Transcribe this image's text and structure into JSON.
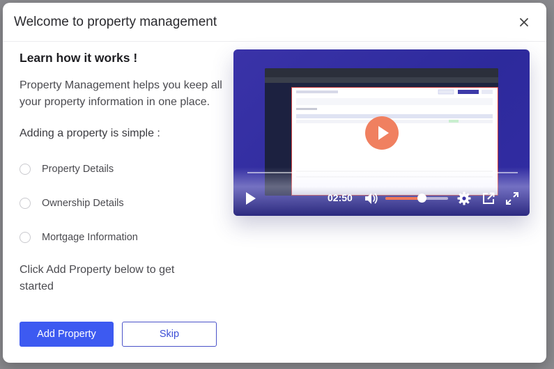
{
  "modal": {
    "title": "Welcome to property management",
    "close_label": "×"
  },
  "intro": {
    "heading": "Learn how it works !",
    "description": "Property Management helps you keep all your property information in one place.",
    "subheading": "Adding a property is simple :",
    "steps": [
      {
        "label": "Property Details"
      },
      {
        "label": "Ownership Details"
      },
      {
        "label": "Mortgage Information"
      }
    ],
    "cta_text": "Click Add Property below to get started"
  },
  "buttons": {
    "add_property": "Add Property",
    "skip": "Skip"
  },
  "video": {
    "time": "02:50",
    "volume_level": 0.58,
    "progress": 0.0
  },
  "colors": {
    "primary": "#3d5af1",
    "video_bg": "#3a33a8",
    "play_button": "#f08060",
    "volume_fill": "#f07a5a"
  }
}
